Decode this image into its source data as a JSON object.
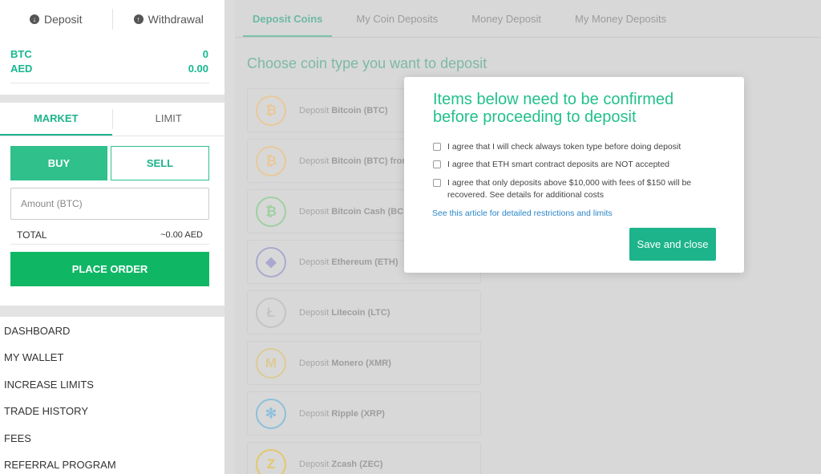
{
  "sidebar": {
    "deposit_label": "Deposit",
    "withdrawal_label": "Withdrawal",
    "balances": [
      {
        "currency": "BTC",
        "amount": "0"
      },
      {
        "currency": "AED",
        "amount": "0.00"
      }
    ],
    "order_tabs": [
      "MARKET",
      "LIMIT"
    ],
    "buy_label": "BUY",
    "sell_label": "SELL",
    "amount_placeholder": "Amount (BTC)",
    "total_label": "TOTAL",
    "total_value": "~0.00 AED",
    "place_order_label": "PLACE ORDER",
    "menu": [
      "DASHBOARD",
      "MY WALLET",
      "INCREASE LIMITS",
      "TRADE HISTORY",
      "FEES",
      "REFERRAL PROGRAM"
    ]
  },
  "main": {
    "tabs": [
      "Deposit Coins",
      "My Coin Deposits",
      "Money Deposit",
      "My Money Deposits"
    ],
    "heading": "Choose coin type you want to deposit",
    "deposit_prefix": "Deposit",
    "coins": [
      {
        "name": "Bitcoin (BTC)",
        "icon": "bitcoin-icon",
        "color": "#e8c99a"
      },
      {
        "name": "Bitcoin (BTC) from",
        "icon": "bitcoin-icon",
        "color": "#e8c99a"
      },
      {
        "name": "Bitcoin Cash (BCH",
        "icon": "bitcoin-cash-icon",
        "color": "#9fd0a2"
      },
      {
        "name": "Ethereum (ETH)",
        "icon": "ethereum-icon",
        "color": "#a9a9cf"
      },
      {
        "name": "Litecoin (LTC)",
        "icon": "litecoin-icon",
        "color": "#c4c4c4"
      },
      {
        "name": "Monero (XMR)",
        "icon": "monero-icon",
        "color": "#dccb96"
      },
      {
        "name": "Ripple (XRP)",
        "icon": "ripple-icon",
        "color": "#8cc0dd"
      },
      {
        "name": "Zcash (ZEC)",
        "icon": "zcash-icon",
        "color": "#e3c86c"
      }
    ]
  },
  "modal": {
    "title": "Items below need to be confirmed before proceeding to deposit",
    "checks": [
      "I agree that I will check always token type before doing deposit",
      "I agree that ETH smart contract deposits are NOT accepted",
      "I agree that only deposits above $10,000 with fees of $150 will be recovered. See details for additional costs"
    ],
    "link_text": "See this article for detailed restrictions and limits",
    "save_label": "Save and close"
  },
  "colors": {
    "accent": "#1db38b",
    "place_order": "#0fb765",
    "link": "#2a86c7"
  }
}
